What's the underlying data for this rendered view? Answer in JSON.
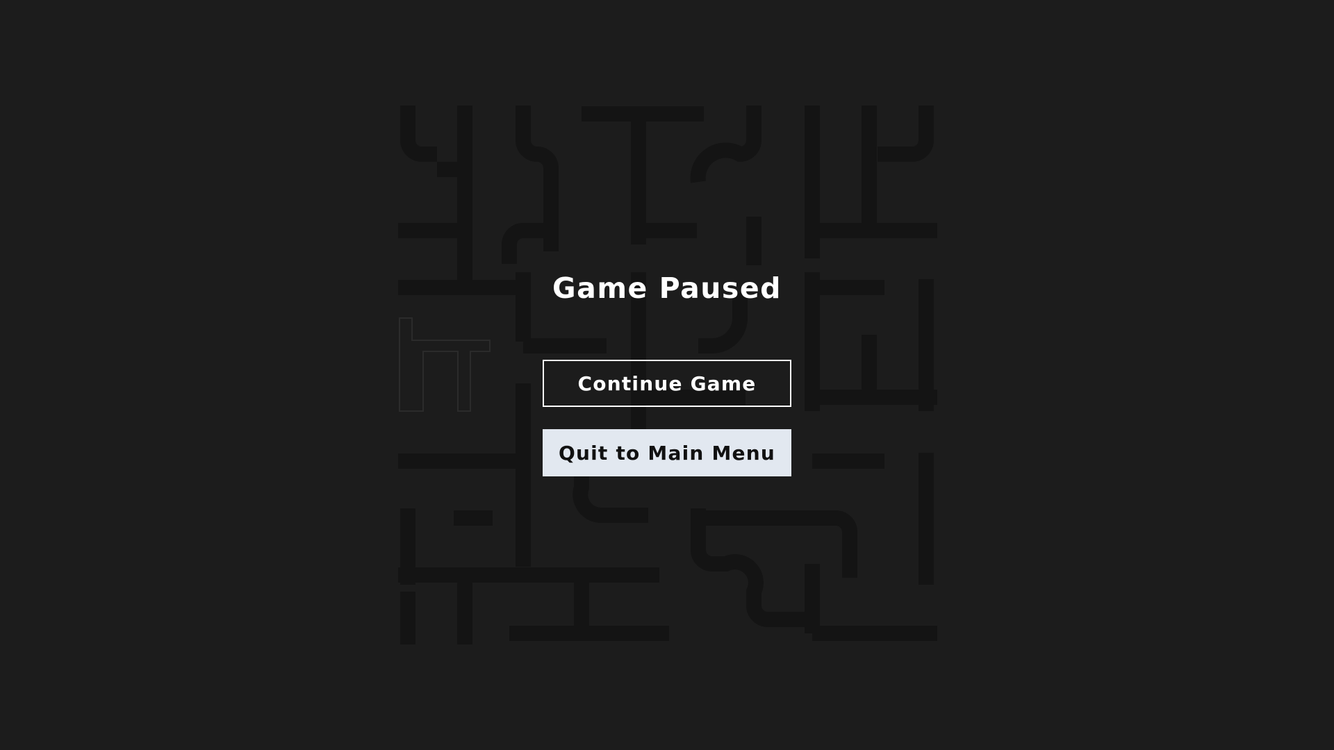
{
  "pause_menu": {
    "title": "Game Paused",
    "continue_label": "Continue Game",
    "quit_label": "Quit to Main Menu"
  },
  "board": {
    "grid_size": "7x7",
    "pipe_color": "#141414",
    "background_color": "#1c1c1c"
  },
  "colors": {
    "overlay_text": "#ffffff",
    "quit_button_bg": "#e2e8f0",
    "quit_button_text": "#111111"
  }
}
